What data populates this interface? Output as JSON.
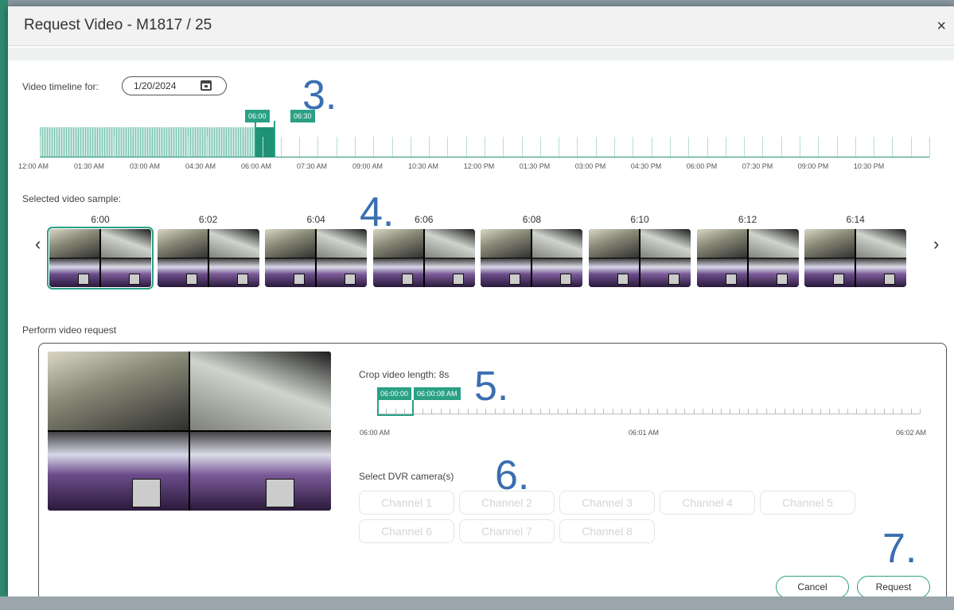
{
  "modal": {
    "title": "Request Video - M1817 / 25",
    "close": "×"
  },
  "timeline": {
    "label": "Video timeline for:",
    "date": "1/20/2024",
    "flag_start": "06:00",
    "flag_end": "06:30",
    "tick_labels": [
      "12:00 AM",
      "01:30 AM",
      "03:00 AM",
      "04:30 AM",
      "06:00 AM",
      "07:30 AM",
      "09:00 AM",
      "10:30 AM",
      "12:00 PM",
      "01:30 PM",
      "03:00 PM",
      "04:30 PM",
      "06:00 PM",
      "07:30 PM",
      "09:00 PM",
      "10:30 PM"
    ]
  },
  "samples": {
    "label": "Selected video sample:",
    "times": [
      "6:00",
      "6:02",
      "6:04",
      "6:06",
      "6:08",
      "6:10",
      "6:12",
      "6:14"
    ],
    "prev": "‹",
    "next": "›"
  },
  "request": {
    "label": "Perform video request",
    "crop_label": "Crop video length: 8s",
    "crop_start": "06:00:00",
    "crop_end": "06:00:08 AM",
    "crop_ticks": [
      "06:00 AM",
      "06:01 AM",
      "06:02 AM"
    ],
    "camera_label": "Select DVR camera(s)",
    "channels": [
      "Channel 1",
      "Channel 2",
      "Channel 3",
      "Channel 4",
      "Channel 5",
      "Channel 6",
      "Channel 7",
      "Channel 8"
    ],
    "cancel": "Cancel",
    "submit": "Request"
  },
  "steps": [
    "3.",
    "4.",
    "5.",
    "6.",
    "7."
  ],
  "colors": {
    "accent": "#2aa085",
    "step": "#3a6fb0"
  }
}
